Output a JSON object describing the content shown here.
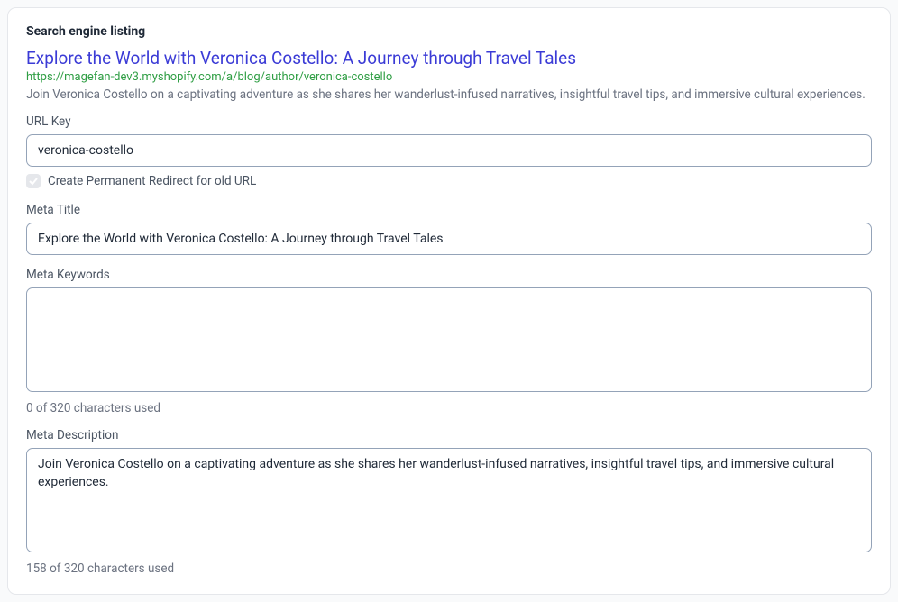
{
  "card": {
    "title": "Search engine listing"
  },
  "preview": {
    "title": "Explore the World with Veronica Costello: A Journey through Travel Tales",
    "url": "https://magefan-dev3.myshopify.com/a/blog/author/veronica-costello",
    "description": "Join Veronica Costello on a captivating adventure as she shares her wanderlust-infused narratives, insightful travel tips, and immersive cultural experiences."
  },
  "url_key": {
    "label": "URL Key",
    "value": "veronica-costello"
  },
  "redirect_checkbox": {
    "label": "Create Permanent Redirect for old URL"
  },
  "meta_title": {
    "label": "Meta Title",
    "value": "Explore the World with Veronica Costello: A Journey through Travel Tales"
  },
  "meta_keywords": {
    "label": "Meta Keywords",
    "value": "",
    "helper": "0 of 320 characters used"
  },
  "meta_description": {
    "label": "Meta Description",
    "value": "Join Veronica Costello on a captivating adventure as she shares her wanderlust-infused narratives, insightful travel tips, and immersive cultural experiences.",
    "helper": "158 of 320 characters used"
  }
}
